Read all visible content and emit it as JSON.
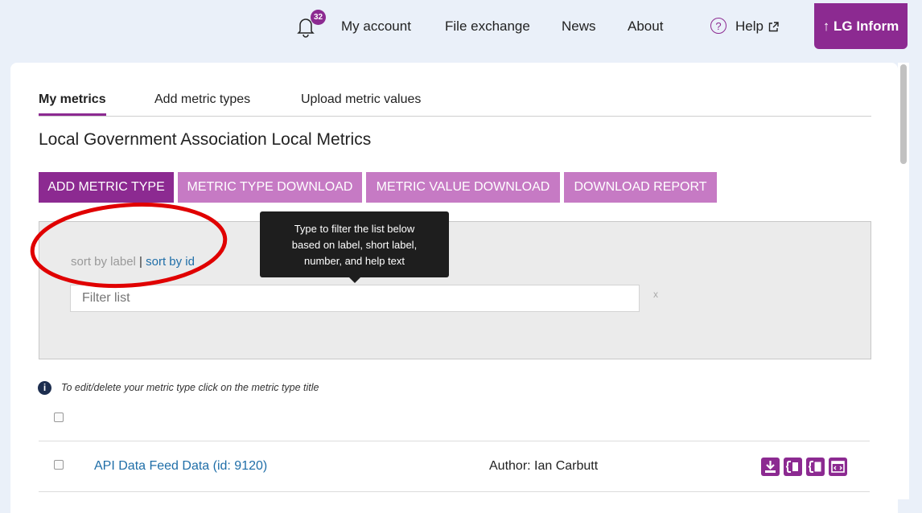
{
  "nav": {
    "notification_count": "32",
    "my_account": "My account",
    "file_exchange": "File exchange",
    "news": "News",
    "about": "About",
    "help_symbol": "?",
    "help": "Help",
    "lg_inform": "↑ LG Inform"
  },
  "tabs": [
    {
      "label": "My metrics",
      "active": true
    },
    {
      "label": "Add metric types"
    },
    {
      "label": "Upload metric values"
    }
  ],
  "page_title": "Local Government Association Local Metrics",
  "buttons": {
    "add_metric_type": "ADD METRIC TYPE",
    "metric_type_download": "METRIC TYPE DOWNLOAD",
    "metric_value_download": "METRIC VALUE DOWNLOAD",
    "download_report": "DOWNLOAD REPORT"
  },
  "filter": {
    "sort_by_label": "sort by label",
    "separator": "|",
    "sort_by_id": "sort by id",
    "placeholder": "Filter list",
    "clear": "x"
  },
  "tooltip": {
    "line1": "Type to filter the list below",
    "line2": "based on label, short label,",
    "line3": "number, and help text"
  },
  "info": {
    "icon": "i",
    "text": "To edit/delete your metric type click on the metric type title"
  },
  "rows": [
    {
      "title": "API Data Feed Data (id: 9120)",
      "author": "Author: Ian Carbutt",
      "actions": [
        "download-icon",
        "export-icon",
        "export-values-icon",
        "code-icon"
      ]
    }
  ],
  "colors": {
    "brand_purple": "#8c2a91",
    "light_purple": "#c67ac4",
    "link_blue": "#1f6ea8",
    "annotation_red": "#e00000"
  }
}
